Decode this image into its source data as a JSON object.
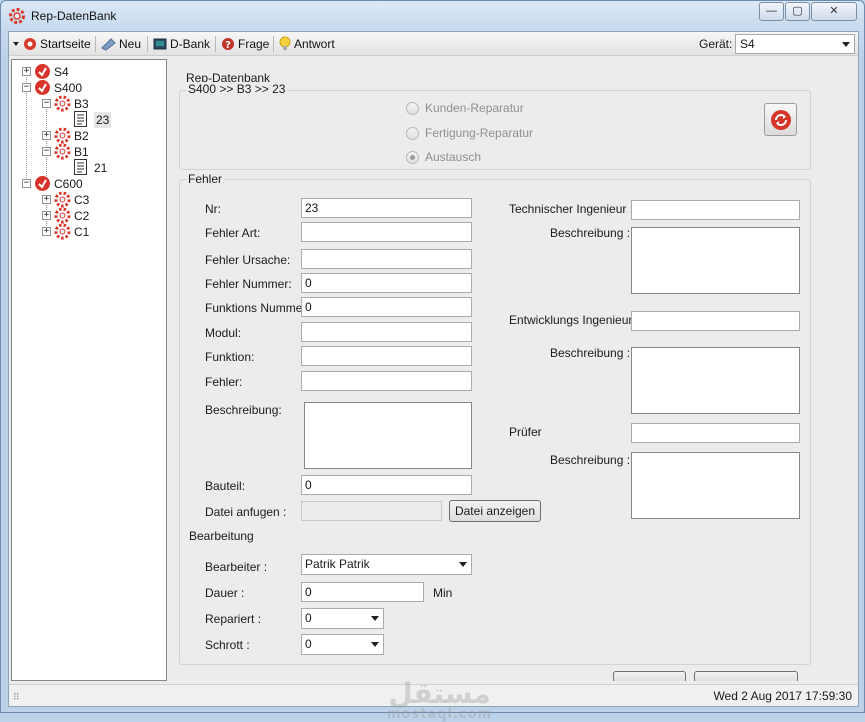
{
  "window": {
    "title": "Rep-DatenBank",
    "min": "—",
    "max": "▢",
    "close": "✕"
  },
  "toolbar": {
    "items": [
      {
        "label": "Startseite",
        "icon": "start-icon"
      },
      {
        "label": "Neu",
        "icon": "new-icon"
      },
      {
        "label": "D-Bank",
        "icon": "database-icon"
      },
      {
        "label": "Frage",
        "icon": "question-icon"
      },
      {
        "label": "Antwort",
        "icon": "bulb-icon"
      }
    ],
    "device_label": "Gerät:",
    "device_value": "S4"
  },
  "tree": {
    "nodes": [
      {
        "label": "S4",
        "level": 0,
        "expander": "+",
        "icon": "device-icon"
      },
      {
        "label": "S400",
        "level": 0,
        "expander": "−",
        "icon": "device-icon"
      },
      {
        "label": "B3",
        "level": 1,
        "expander": "−",
        "icon": "gear-icon"
      },
      {
        "label": "23",
        "level": 2,
        "expander": "",
        "icon": "document-icon",
        "selected": true
      },
      {
        "label": "B2",
        "level": 1,
        "expander": "+",
        "icon": "gear-icon"
      },
      {
        "label": "B1",
        "level": 1,
        "expander": "−",
        "icon": "gear-icon"
      },
      {
        "label": "21",
        "level": 2,
        "expander": "",
        "icon": "document-icon"
      },
      {
        "label": "C600",
        "level": 0,
        "expander": "−",
        "icon": "device-icon"
      },
      {
        "label": "C3",
        "level": 1,
        "expander": "+",
        "icon": "gear-icon"
      },
      {
        "label": "C2",
        "level": 1,
        "expander": "+",
        "icon": "gear-icon"
      },
      {
        "label": "C1",
        "level": 1,
        "expander": "+",
        "icon": "gear-icon"
      }
    ]
  },
  "header": {
    "title": "Rep-Datenbank",
    "path": "S400 >> B3 >> 23",
    "radios": [
      {
        "label": "Kunden-Reparatur",
        "checked": false
      },
      {
        "label": "Fertigung-Reparatur",
        "checked": false
      },
      {
        "label": "Austausch",
        "checked": true
      }
    ]
  },
  "fehler": {
    "group_title": "Fehler",
    "nr_label": "Nr:",
    "nr_value": "23",
    "art_label": "Fehler Art:",
    "art_value": "",
    "ursache_label": "Fehler Ursache:",
    "ursache_value": "",
    "nummer_label": "Fehler Nummer:",
    "nummer_value": "0",
    "funktionsnummer_label": "Funktions Nummer:",
    "funktionsnummer_value": "0",
    "modul_label": "Modul:",
    "modul_value": "",
    "funktion_label": "Funktion:",
    "funktion_value": "",
    "fehler_label": "Fehler:",
    "fehler_value": "",
    "beschreibung_label": "Beschreibung:",
    "bauteil_label": "Bauteil:",
    "bauteil_value": "0",
    "datei_label": "Datei anfugen :",
    "datei_value": "",
    "datei_button": "Datei anzeigen",
    "tech_label": "Technischer Ingenieur :",
    "tech_value": "",
    "tech_desc_label": "Beschreibung :",
    "entw_label": "Entwicklungs Ingenieur :",
    "entw_value": "",
    "entw_desc_label": "Beschreibung :",
    "pruefer_label": "Prüfer",
    "pruefer_value": "",
    "pruefer_desc_label": "Beschreibung :"
  },
  "bearbeitung": {
    "title": "Bearbeitung",
    "bearbeiter_label": "Bearbeiter :",
    "bearbeiter_value": "Patrik Patrik",
    "dauer_label": "Dauer :",
    "dauer_value": "0",
    "dauer_unit": "Min",
    "repariert_label": "Repariert :",
    "repariert_value": "0",
    "schrott_label": "Schrott :",
    "schrott_value": "0"
  },
  "statusbar": {
    "datetime": "Wed 2 Aug 2017  17:59:30"
  },
  "watermark": {
    "arabic": "مستقل",
    "latin": "mostaql.com"
  }
}
